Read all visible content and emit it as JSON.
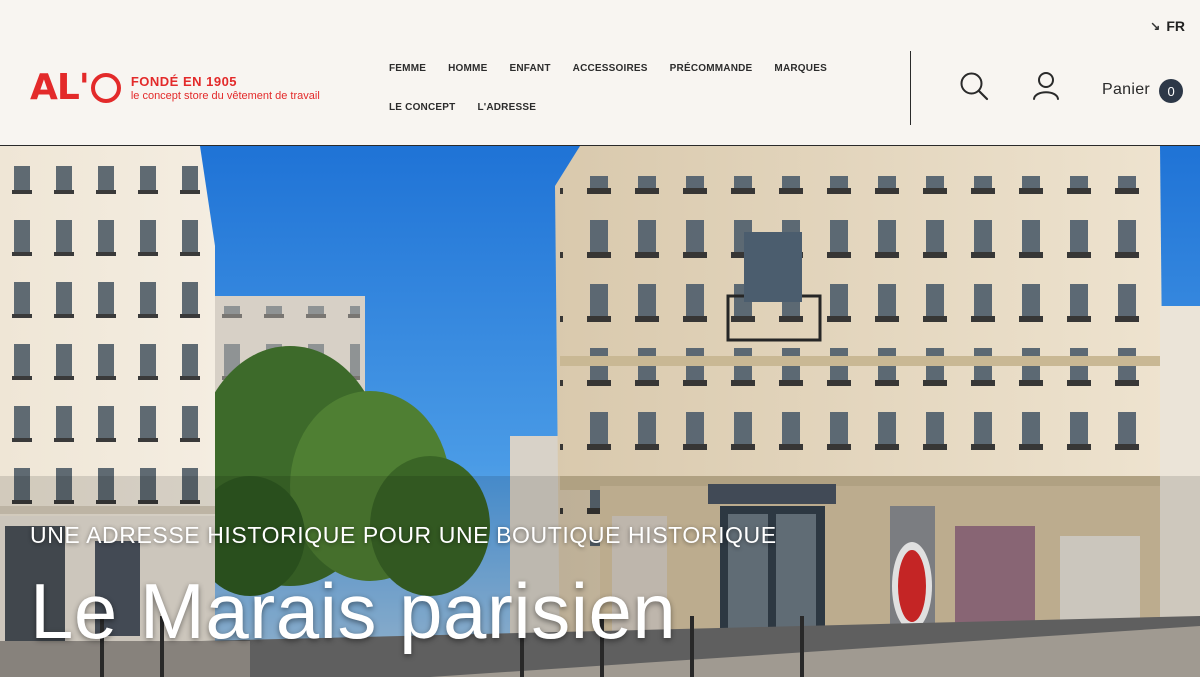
{
  "header": {
    "language": "FR",
    "logo": {
      "mark": "AL'",
      "title": "FONDÉ EN 1905",
      "subtitle": "le concept store du vêtement de travail"
    },
    "nav": [
      {
        "label": "FEMME"
      },
      {
        "label": "HOMME"
      },
      {
        "label": "ENFANT"
      },
      {
        "label": "ACCESSOIRES"
      },
      {
        "label": "PRÉCOMMANDE"
      },
      {
        "label": "MARQUES"
      },
      {
        "label": "LE CONCEPT"
      },
      {
        "label": "L'ADRESSE"
      }
    ],
    "cart": {
      "label": "Panier",
      "count": "0"
    },
    "icons": {
      "search": "search-icon",
      "account": "user-icon",
      "language_arrow": "arrow-down-right-icon"
    }
  },
  "hero": {
    "eyebrow": "UNE ADRESSE HISTORIQUE POUR UNE BOUTIQUE HISTORIQUE",
    "title": "Le Marais parisien"
  },
  "colors": {
    "brand": "#e32a2a",
    "header_bg": "#f8f5f1",
    "badge": "#2d3848"
  }
}
